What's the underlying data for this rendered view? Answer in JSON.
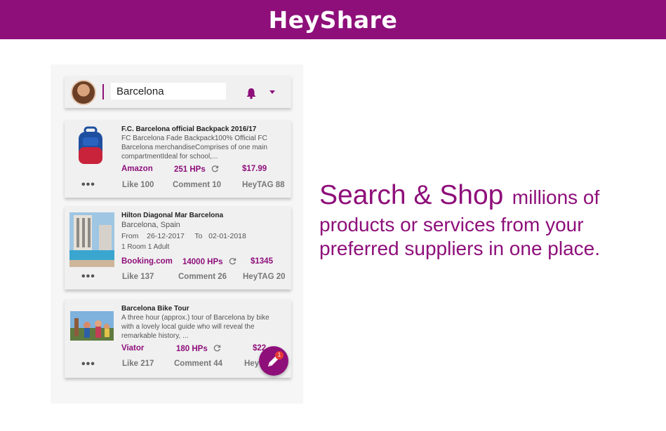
{
  "brand": "HeyShare",
  "search": {
    "value": "Barcelona"
  },
  "cards": [
    {
      "title": "F.C. Barcelona official Backpack 2016/17",
      "desc": "FC Barcelona Fade Backpack100% Official FC Barcelona merchandiseComprises of one main compartmentIdeal for school,...",
      "supplier": "Amazon",
      "hps": "251 HPs",
      "price": "$17.99",
      "like": "Like 100",
      "comment": "Comment 10",
      "heytag": "HeyTAG 88"
    },
    {
      "title": "Hilton Diagonal Mar Barcelona",
      "location": "Barcelona, Spain",
      "from_label": "From",
      "from_date": "26-12-2017",
      "to_label": "To",
      "to_date": "02-01-2018",
      "rooms": "1 Room  1 Adult",
      "supplier": "Booking.com",
      "hps": "14000 HPs",
      "price": "$1345",
      "like": "Like 137",
      "comment": "Comment  26",
      "heytag": "HeyTAG 20"
    },
    {
      "title": "Barcelona Bike Tour",
      "desc": "A three hour (approx.) tour of Barcelona by bike with a lovely local guide who will reveal the remarkable history, ...",
      "supplier": "Viator",
      "hps": "180 HPs",
      "price": "$22",
      "like": "Like 217",
      "comment": "Comment 44",
      "heytag": "HeyTAG"
    }
  ],
  "dots": "•••",
  "fab_badge": "1",
  "headline": {
    "big": "Search & Shop",
    "rest1": "millions of",
    "line2": "products or services from your",
    "line3": "preferred suppliers in one place."
  },
  "colors": {
    "brand": "#8e0f7a",
    "badge": "#e53935"
  }
}
